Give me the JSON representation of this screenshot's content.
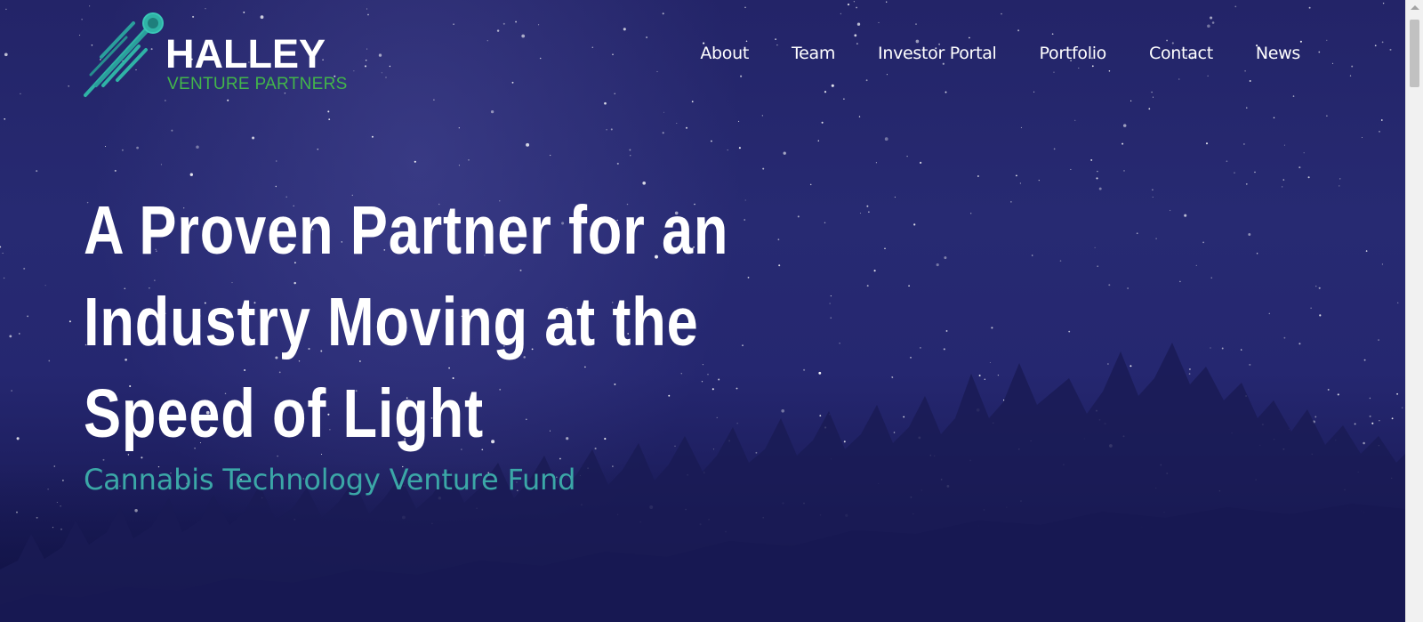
{
  "logo": {
    "title": "HALLEY",
    "subtitle": "VENTURE PARTNERS",
    "icon": "comet-icon",
    "title_color": "#ffffff",
    "subtitle_color": "#42b54a",
    "icon_color": "#2fb3a6"
  },
  "nav": {
    "items": [
      {
        "label": "About"
      },
      {
        "label": "Team"
      },
      {
        "label": "Investor Portal"
      },
      {
        "label": "Portfolio"
      },
      {
        "label": "Contact"
      },
      {
        "label": "News"
      }
    ]
  },
  "hero": {
    "headline_lines": [
      "A Proven Partner for an",
      "Industry Moving at the",
      "Speed of Light"
    ],
    "tagline": "Cannabis Technology Venture Fund",
    "tagline_color": "#3ba7a7",
    "background": "night-sky-with-tree-silhouettes"
  }
}
